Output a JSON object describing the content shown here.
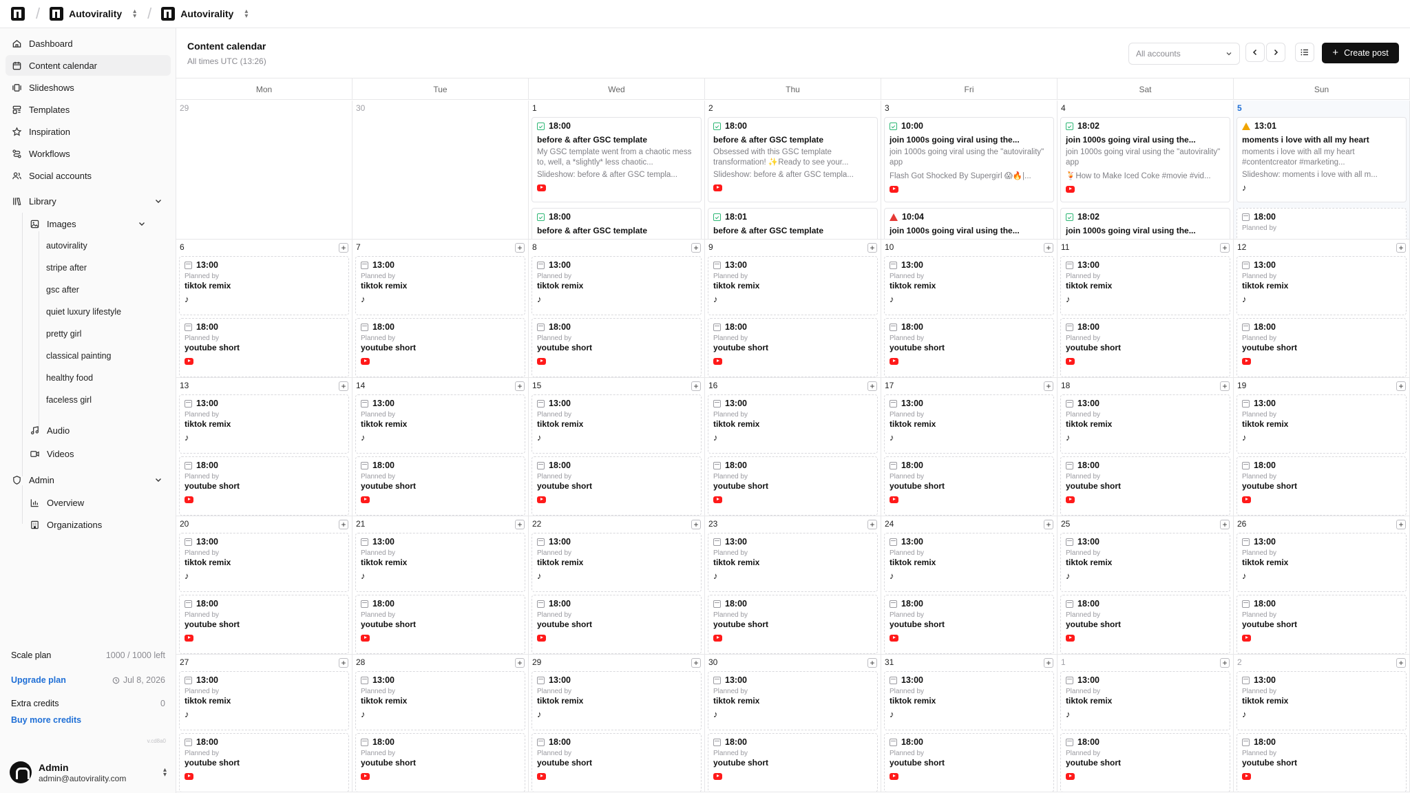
{
  "topbar": {
    "org_name": "Autovirality",
    "project_name": "Autovirality"
  },
  "sidebar": {
    "items": [
      {
        "label": "Dashboard",
        "icon": "home-icon"
      },
      {
        "label": "Content calendar",
        "icon": "calendar-icon"
      },
      {
        "label": "Slideshows",
        "icon": "slideshow-icon"
      },
      {
        "label": "Templates",
        "icon": "template-icon"
      },
      {
        "label": "Inspiration",
        "icon": "star-icon"
      },
      {
        "label": "Workflows",
        "icon": "workflow-icon"
      },
      {
        "label": "Social accounts",
        "icon": "users-icon"
      }
    ],
    "library": {
      "label": "Library",
      "images_label": "Images",
      "images": [
        "autovirality",
        "stripe after",
        "gsc after",
        "quiet luxury lifestyle",
        "pretty girl",
        "classical painting",
        "healthy food",
        "faceless girl"
      ],
      "audio_label": "Audio",
      "videos_label": "Videos"
    },
    "admin": {
      "label": "Admin",
      "items": [
        "Overview",
        "Organizations"
      ]
    },
    "plan": {
      "name": "Scale plan",
      "usage": "1000 / 1000 left",
      "upgrade": "Upgrade plan",
      "renew_date": "Jul 8, 2026",
      "extra_label": "Extra credits",
      "extra_value": "0",
      "buy_more": "Buy more credits"
    },
    "version": "v.cd8a0",
    "user": {
      "name": "Admin",
      "email": "admin@autovirality.com"
    }
  },
  "header": {
    "title": "Content calendar",
    "subtitle": "All times UTC (13:26)",
    "accounts_select": "All accounts",
    "create_post": "Create post"
  },
  "calendar": {
    "weekdays": [
      "Mon",
      "Tue",
      "Wed",
      "Thu",
      "Fri",
      "Sat",
      "Sun"
    ],
    "planned_by": "Planned by",
    "week1": [
      {
        "day": "29",
        "dim": true,
        "posts": []
      },
      {
        "day": "30",
        "dim": true,
        "posts": []
      },
      {
        "day": "1",
        "posts": [
          {
            "time": "18:00",
            "status": "ok",
            "title": "before & after GSC template",
            "body": "My GSC template went from a chaotic mess to, well, a *slightly* less chaotic...",
            "slide": "Slideshow: before & after GSC templa...",
            "platform": "youtube"
          },
          {
            "time": "18:00",
            "status": "ok",
            "title": "before & after GSC template"
          }
        ]
      },
      {
        "day": "2",
        "posts": [
          {
            "time": "18:00",
            "status": "ok",
            "title": "before & after GSC template",
            "body": "Obsessed with this GSC template transformation! ✨Ready to see your...",
            "slide": "Slideshow: before & after GSC templa...",
            "platform": "youtube"
          },
          {
            "time": "18:01",
            "status": "ok",
            "title": "before & after GSC template"
          }
        ]
      },
      {
        "day": "3",
        "posts": [
          {
            "time": "10:00",
            "status": "ok",
            "title": "join 1000s going viral using the...",
            "body": "join 1000s going viral using the \"autovirality\" app",
            "slide": "Flash Got Shocked By Supergirl 😱🔥|...",
            "platform": "youtube"
          },
          {
            "time": "10:04",
            "status": "err",
            "title": "join 1000s going viral using the..."
          }
        ]
      },
      {
        "day": "4",
        "posts": [
          {
            "time": "18:02",
            "status": "ok",
            "title": "join 1000s going viral using the...",
            "body": "join 1000s going viral using the \"autovirality\" app",
            "slide": "🍹How to Make Iced Coke #movie #vid...",
            "platform": "youtube"
          },
          {
            "time": "18:02",
            "status": "ok",
            "title": "join 1000s going viral using the..."
          }
        ]
      },
      {
        "day": "5",
        "today": true,
        "posts": [
          {
            "time": "13:01",
            "status": "warn",
            "title": "moments i love with all my heart",
            "body": "moments i love with all my heart #contentcreator #marketing...",
            "slide": "Slideshow: moments i love with all m...",
            "platform": "tiktok"
          },
          {
            "time": "18:00",
            "status": "plan",
            "title": ""
          }
        ]
      }
    ],
    "plan_rows": [
      {
        "days": [
          "6",
          "7",
          "8",
          "9",
          "10",
          "11",
          "12"
        ]
      },
      {
        "days": [
          "13",
          "14",
          "15",
          "16",
          "17",
          "18",
          "19"
        ]
      },
      {
        "days": [
          "20",
          "21",
          "22",
          "23",
          "24",
          "25",
          "26"
        ]
      },
      {
        "days": [
          "27",
          "28",
          "29",
          "30",
          "31",
          "1",
          "2"
        ],
        "dim_from": 5
      }
    ],
    "planned_posts": [
      {
        "time": "13:00",
        "name": "tiktok remix",
        "platform": "tiktok"
      },
      {
        "time": "18:00",
        "name": "youtube short",
        "platform": "youtube"
      }
    ]
  },
  "colors": {
    "accent": "#1f6fd6",
    "ok": "#2bb673",
    "warn": "#f0a400",
    "error": "#e53935",
    "youtube": "#ff1a1a"
  }
}
